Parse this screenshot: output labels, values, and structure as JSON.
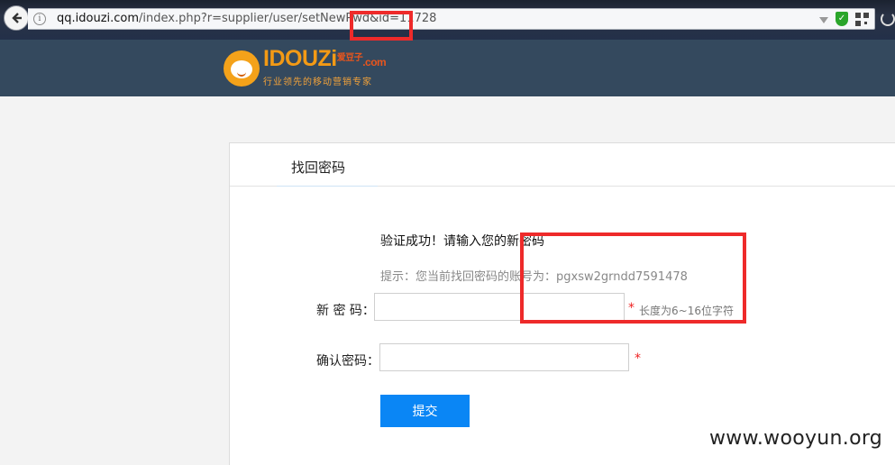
{
  "browser": {
    "url_domain": "qq.idouzi.com",
    "url_path": "/index.php?r=supplier/user/setNewPwd&id=11728",
    "info_glyph": "i",
    "icons": [
      "back-arrow-icon",
      "info-icon",
      "dropdown-arrow-icon",
      "shield-icon",
      "qr-code-icon",
      "reload-icon"
    ]
  },
  "site": {
    "logo_brand": "IDOUZi",
    "logo_sup": "爱豆子",
    "logo_com": ".com",
    "logo_slogan": "行业领先的移动营销专家"
  },
  "card": {
    "title": "找回密码",
    "message": "验证成功！请输入您的新密码",
    "tip": "提示：您当前找回密码的账号为：pgxsw2grndd7591478",
    "new_password_label": "新 密 码：",
    "confirm_password_label": "确认密码：",
    "required_mark": "*",
    "length_hint": "长度为6~16位字符",
    "submit_label": "提交"
  },
  "annotations": {
    "color": "#ee2a2a"
  },
  "watermark": "www.wooyun.org",
  "colors": {
    "header_bg": "#34495e",
    "submit_bg": "#0a86f5",
    "logo_orange": "#f39a15"
  }
}
